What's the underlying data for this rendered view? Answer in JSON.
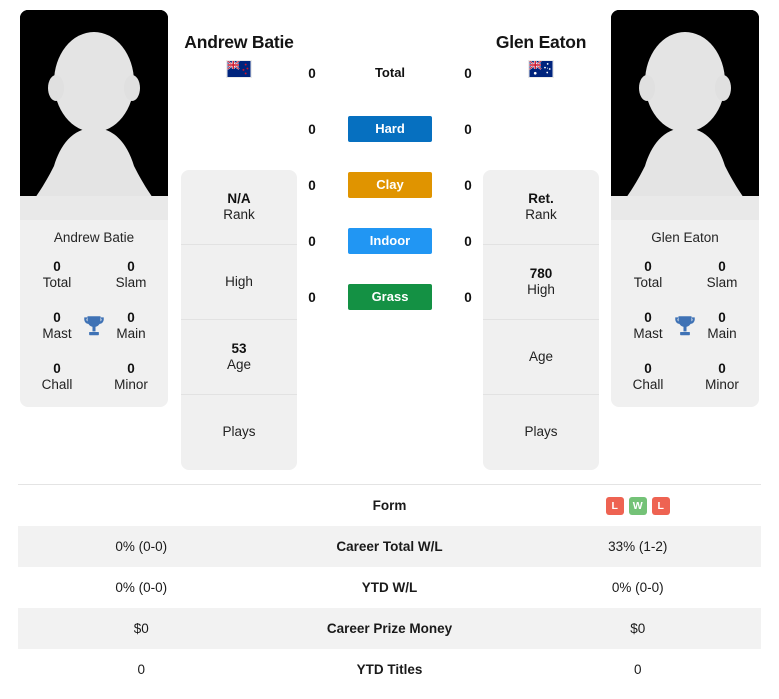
{
  "players": {
    "left": {
      "name": "Andrew Batie",
      "card_name": "Andrew Batie",
      "flag": "new-zealand-flag",
      "titles": [
        {
          "value": "0",
          "label": "Total"
        },
        {
          "value": "0",
          "label": "Slam"
        },
        {
          "value": "0",
          "label": "Mast"
        },
        {
          "value": "0",
          "label": "Main"
        },
        {
          "value": "0",
          "label": "Chall"
        },
        {
          "value": "0",
          "label": "Minor"
        }
      ],
      "info": [
        {
          "value": "N/A",
          "label": "Rank"
        },
        {
          "value": "",
          "label": "High"
        },
        {
          "value": "53",
          "label": "Age"
        },
        {
          "value": "",
          "label": "Plays"
        }
      ],
      "surface_counts": [
        "0",
        "0",
        "0",
        "0",
        "0"
      ],
      "form": [],
      "table_values": [
        "0% (0-0)",
        "0% (0-0)",
        "$0",
        "0"
      ]
    },
    "right": {
      "name": "Glen Eaton",
      "card_name": "Glen Eaton",
      "flag": "australia-flag",
      "titles": [
        {
          "value": "0",
          "label": "Total"
        },
        {
          "value": "0",
          "label": "Slam"
        },
        {
          "value": "0",
          "label": "Mast"
        },
        {
          "value": "0",
          "label": "Main"
        },
        {
          "value": "0",
          "label": "Chall"
        },
        {
          "value": "0",
          "label": "Minor"
        }
      ],
      "info": [
        {
          "value": "Ret.",
          "label": "Rank"
        },
        {
          "value": "780",
          "label": "High"
        },
        {
          "value": "",
          "label": "Age"
        },
        {
          "value": "",
          "label": "Plays"
        }
      ],
      "surface_counts": [
        "0",
        "0",
        "0",
        "0",
        "0"
      ],
      "form": [
        {
          "result": "L",
          "color": "#ee6352"
        },
        {
          "result": "W",
          "color": "#74c277"
        },
        {
          "result": "L",
          "color": "#ee6352"
        }
      ],
      "table_values": [
        "33% (1-2)",
        "0% (0-0)",
        "$0",
        "0"
      ]
    }
  },
  "surfaces": [
    {
      "label": "Total",
      "color": "",
      "plain": true
    },
    {
      "label": "Hard",
      "color": "#0670c0",
      "plain": false
    },
    {
      "label": "Clay",
      "color": "#e09400",
      "plain": false
    },
    {
      "label": "Indoor",
      "color": "#2196f3",
      "plain": false
    },
    {
      "label": "Grass",
      "color": "#149144",
      "plain": false
    }
  ],
  "table_rows": [
    {
      "label": "Form"
    },
    {
      "label": "Career Total W/L"
    },
    {
      "label": "YTD W/L"
    },
    {
      "label": "Career Prize Money"
    },
    {
      "label": "YTD Titles"
    }
  ],
  "colors": {
    "card_bg": "#f0f0f0",
    "stripe": "#f2f2f2",
    "trophy": "#3f72b5",
    "photo_bg": "#000000"
  }
}
